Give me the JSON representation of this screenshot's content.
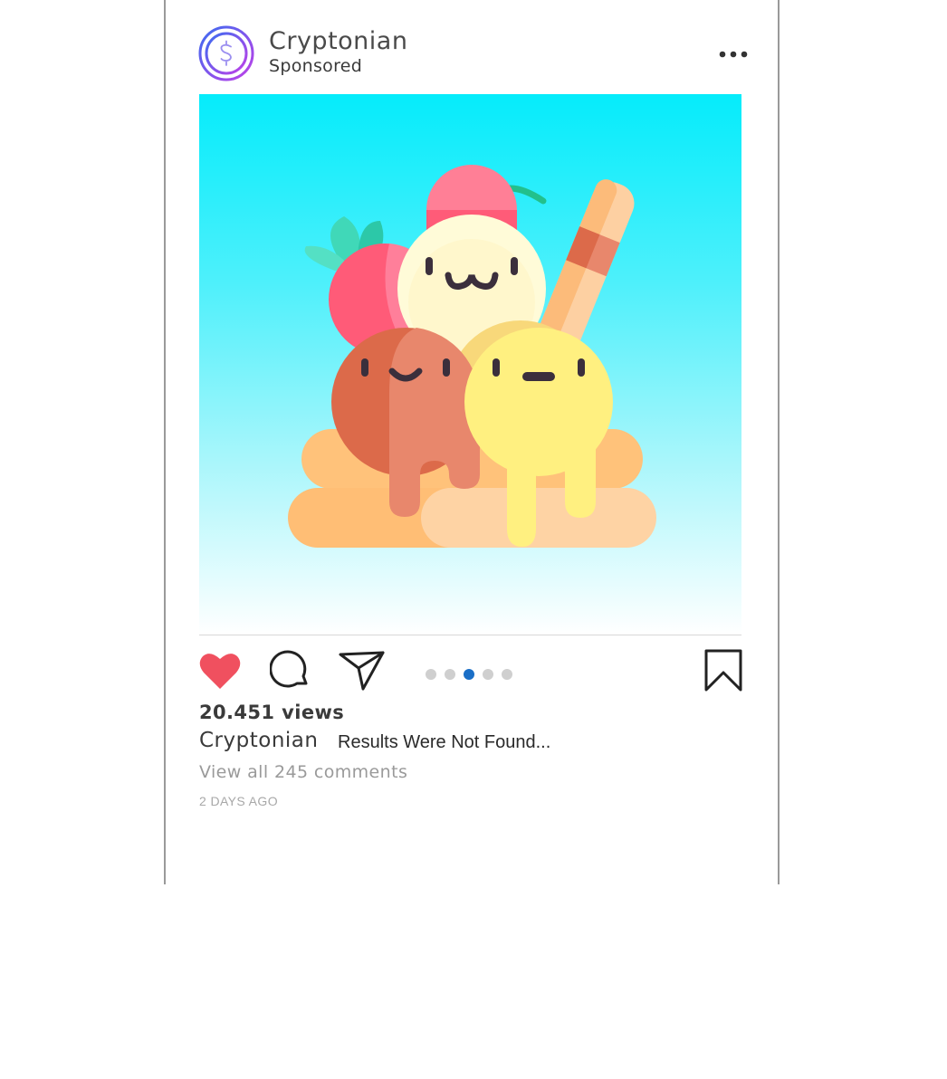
{
  "post": {
    "username": "Cryptonian",
    "sponsored_label": "Sponsored",
    "avatar_icon": "dollar-sign-icon",
    "image_alt": "ice-cream-illustration",
    "views": "20.451 views",
    "caption_user": "Cryptonian",
    "caption_text": "Results Were Not Found...",
    "comments_link": "View all 245 comments",
    "timestamp": "2 DAYS AGO",
    "carousel": {
      "count": 5,
      "active_index": 2
    }
  },
  "actions": {
    "like_icon": "heart-icon",
    "comment_icon": "comment-icon",
    "share_icon": "send-icon",
    "save_icon": "bookmark-icon",
    "more_icon": "more-options-icon"
  },
  "colors": {
    "heart": "#f0505f",
    "carousel_active": "#1a6fc7",
    "carousel_inactive": "#cfcfcf",
    "image_gradient_top": "#05ecfb",
    "avatar_ring_start": "#3b6cf0",
    "avatar_ring_end": "#c040e8"
  }
}
